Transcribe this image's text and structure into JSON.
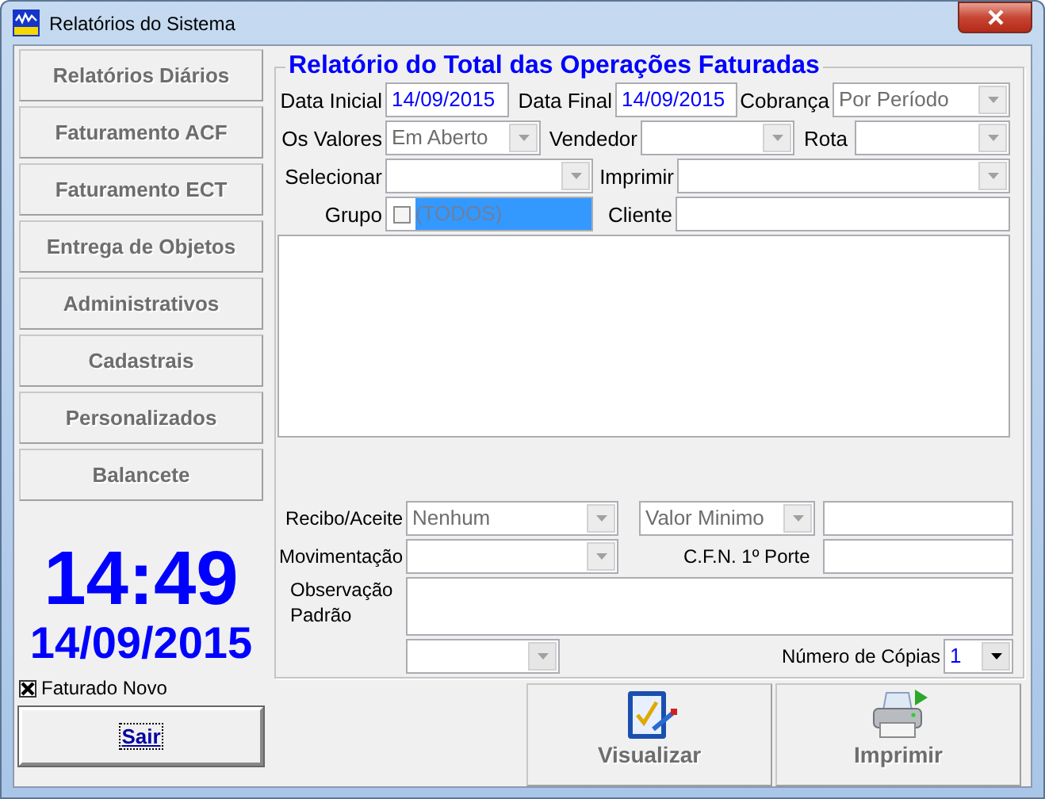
{
  "window": {
    "title": "Relatórios do Sistema"
  },
  "menu": [
    {
      "label": "Relatórios Diários",
      "disabled": true
    },
    {
      "label": "Faturamento ACF",
      "disabled": true
    },
    {
      "label": "Faturamento ECT",
      "disabled": true
    },
    {
      "label": "Entrega de Objetos",
      "disabled": true
    },
    {
      "label": "Administrativos",
      "disabled": true
    },
    {
      "label": "Cadastrais",
      "disabled": true
    },
    {
      "label": "Personalizados",
      "disabled": true
    },
    {
      "label": "Balancete",
      "disabled": true
    }
  ],
  "clock": {
    "time": "14:49",
    "date": "14/09/2015"
  },
  "faturado_novo": {
    "label": "Faturado Novo",
    "checked": true
  },
  "exit_button": {
    "label": "Sair"
  },
  "report": {
    "title": "Relatório do Total das Operações Faturadas",
    "rows": [
      [
        {
          "kind": "label",
          "text": "Data Inicial"
        },
        {
          "kind": "input",
          "value": "14/09/2015"
        },
        {
          "kind": "label",
          "text": "Data Final"
        },
        {
          "kind": "input",
          "value": "14/09/2015"
        },
        {
          "kind": "label",
          "text": "Cobrança"
        },
        {
          "kind": "combo",
          "value": "Por Período",
          "disabled": true
        }
      ],
      [
        {
          "kind": "label",
          "text": "Os Valores"
        },
        {
          "kind": "combo",
          "value": "Em Aberto",
          "disabled": true
        },
        {
          "kind": "label",
          "text": "Vendedor"
        },
        {
          "kind": "combo",
          "disabled": true
        },
        {
          "kind": "label",
          "text": "Rota"
        },
        {
          "kind": "combo",
          "disabled": true
        }
      ],
      [
        {
          "kind": "label",
          "text": "Selecionar"
        },
        {
          "kind": "combo",
          "disabled": true
        },
        {
          "kind": "label",
          "text": "Imprimir"
        },
        {
          "kind": "combo",
          "disabled": true
        }
      ],
      [
        {
          "kind": "label",
          "text": "Grupo"
        },
        {
          "kind": "checklist",
          "items": [
            {
              "label": "(TODOS)",
              "checked": false,
              "selected": true
            }
          ]
        },
        {
          "kind": "label",
          "text": "Cliente"
        },
        {
          "kind": "input"
        }
      ]
    ],
    "lower_rows": [
      [
        {
          "kind": "label",
          "text": "Recibo/Aceite"
        },
        {
          "kind": "combo",
          "value": "Nenhum",
          "disabled": true
        },
        {
          "kind": "combo",
          "value": "Valor Minimo",
          "disabled": true
        },
        {
          "kind": "input"
        }
      ],
      [
        {
          "kind": "label",
          "text": "Movimentação"
        },
        {
          "kind": "combo",
          "disabled": true
        },
        {
          "kind": "label",
          "text": "C.F.N. 1º Porte"
        },
        {
          "kind": "input"
        }
      ],
      [
        {
          "kind": "label",
          "text": "Observação Padrão"
        },
        {
          "kind": "textarea"
        }
      ],
      [
        {
          "kind": "combo",
          "disabled": true
        },
        {
          "kind": "label",
          "text": "Número de Cópias"
        },
        {
          "kind": "combo",
          "value": "1",
          "disabled": false
        }
      ]
    ]
  },
  "actions": [
    {
      "label": "Visualizar",
      "kind": "preview",
      "disabled": true
    },
    {
      "label": "Imprimir",
      "kind": "print",
      "disabled": true
    }
  ]
}
